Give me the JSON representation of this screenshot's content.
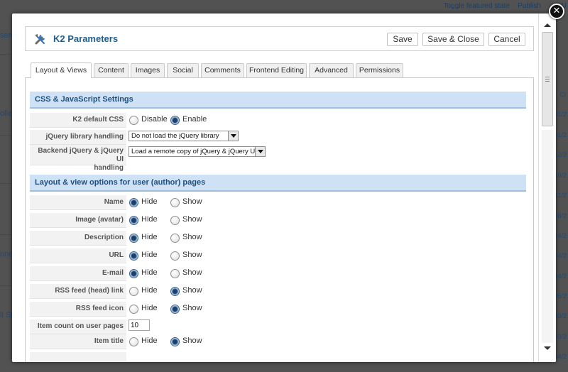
{
  "background": {
    "top_links": [
      "Toggle featured state",
      "Publish",
      "U"
    ],
    "left_fragments": [
      "sers",
      "olle",
      "nne",
      "ll St"
    ],
    "right_fragments": [
      "Cr",
      "01/2",
      "01/2",
      "12/2",
      "10/2",
      "11/2",
      "08/2",
      "04/2",
      "04/2",
      "04/2",
      "05/2",
      "03/2",
      "03/2",
      "04/2"
    ]
  },
  "modal": {
    "close_symbol": "✕",
    "title": "K2 Parameters",
    "buttons": {
      "save": "Save",
      "save_close": "Save & Close",
      "cancel": "Cancel"
    }
  },
  "tabs": [
    {
      "label": "Layout & Views",
      "active": true
    },
    {
      "label": "Content",
      "active": false
    },
    {
      "label": "Images",
      "active": false
    },
    {
      "label": "Social",
      "active": false
    },
    {
      "label": "Comments",
      "active": false
    },
    {
      "label": "Frontend Editing",
      "active": false
    },
    {
      "label": "Advanced",
      "active": false
    },
    {
      "label": "Permissions",
      "active": false
    }
  ],
  "sections": {
    "css_js": {
      "title": "CSS & JavaScript Settings",
      "k2_css": {
        "label": "K2 default CSS",
        "options": [
          "Disable",
          "Enable"
        ],
        "selected": "Enable"
      },
      "jquery": {
        "label": "jQuery library handling",
        "value": "Do not load the jQuery library"
      },
      "backend_jquery": {
        "label_line1": "Backend jQuery & jQuery UI",
        "label_line2": "handling",
        "value": "Load a remote copy of jQuery & jQuery UI"
      }
    },
    "user_pages": {
      "title": "Layout & view options for user (author) pages",
      "option_labels": [
        "Hide",
        "Show"
      ],
      "rows": [
        {
          "label": "Name",
          "selected": "Hide"
        },
        {
          "label": "Image (avatar)",
          "selected": "Hide"
        },
        {
          "label": "Description",
          "selected": "Hide"
        },
        {
          "label": "URL",
          "selected": "Hide"
        },
        {
          "label": "E-mail",
          "selected": "Hide"
        },
        {
          "label": "RSS feed (head) link",
          "selected": "Show"
        },
        {
          "label": "RSS feed icon",
          "selected": "Show"
        }
      ],
      "item_count": {
        "label": "Item count on user pages",
        "value": "10"
      },
      "item_title": {
        "label": "Item title",
        "selected": "Show"
      }
    }
  },
  "colors": {
    "section_header_bg": "#cfe2f5",
    "title_blue": "#1f5d8e",
    "overlay": "#525252"
  }
}
